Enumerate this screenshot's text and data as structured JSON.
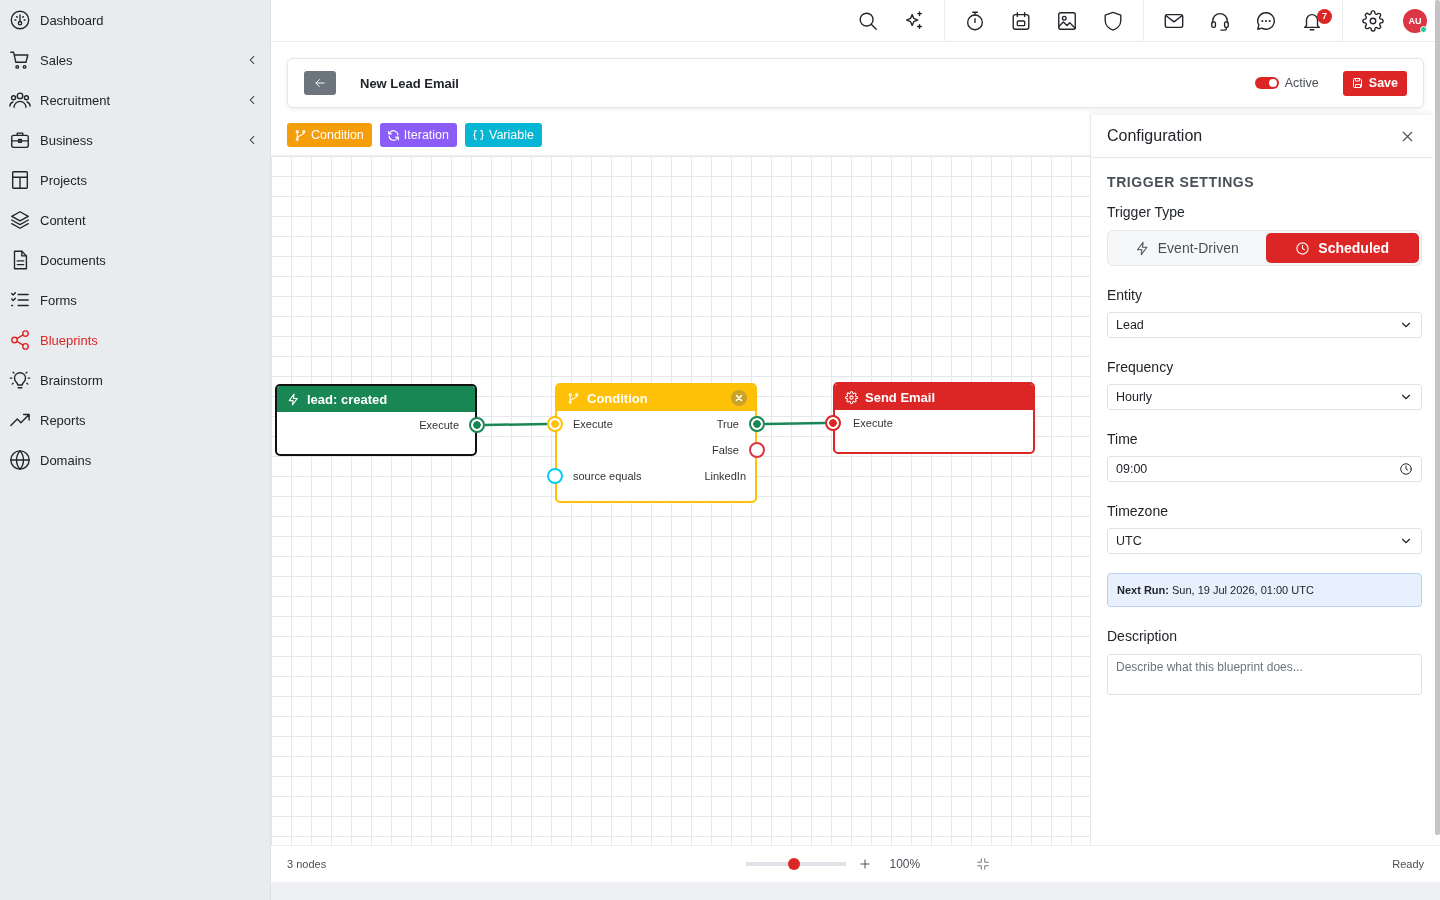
{
  "sidebar": {
    "items": [
      {
        "label": "Dashboard",
        "kind": "link",
        "selected": false
      },
      {
        "label": "Sales",
        "kind": "group",
        "selected": false
      },
      {
        "label": "Recruitment",
        "kind": "group",
        "selected": false
      },
      {
        "label": "Business",
        "kind": "group",
        "selected": false
      },
      {
        "label": "Projects",
        "kind": "link",
        "selected": false
      },
      {
        "label": "Content",
        "kind": "link",
        "selected": false
      },
      {
        "label": "Documents",
        "kind": "link",
        "selected": false
      },
      {
        "label": "Forms",
        "kind": "link",
        "selected": false
      },
      {
        "label": "Blueprints",
        "kind": "link",
        "selected": true
      },
      {
        "label": "Brainstorm",
        "kind": "link",
        "selected": false
      },
      {
        "label": "Reports",
        "kind": "link",
        "selected": false
      },
      {
        "label": "Domains",
        "kind": "link",
        "selected": false
      }
    ]
  },
  "top_bar": {
    "notification_badge": "7",
    "avatar": {
      "initials": "AU",
      "online": true
    }
  },
  "header": {
    "title": "New Lead Email",
    "active_toggle": {
      "label": "Active",
      "on": true
    },
    "save_button": "Save"
  },
  "node_palette": [
    {
      "label": "Condition",
      "color": "#f59e0b"
    },
    {
      "label": "Iteration",
      "color": "#8b5cf6"
    },
    {
      "label": "Variable",
      "color": "#06b6d4"
    }
  ],
  "canvas": {
    "nodes": [
      {
        "kind": "trigger",
        "title": "lead: created",
        "color": "#198754",
        "selected": true,
        "rows": [
          {
            "right": {
              "label": "Execute",
              "port": {
                "color": "#198754",
                "connected": true
              }
            }
          }
        ]
      },
      {
        "kind": "condition",
        "title": "Condition",
        "color": "#ffc107",
        "selected": false,
        "rows": [
          {
            "left": {
              "label": "Execute",
              "port": {
                "color": "#ffc107",
                "connected": true
              }
            },
            "right": {
              "label": "True",
              "port": {
                "color": "#198754",
                "connected": true
              }
            }
          },
          {
            "right": {
              "label": "False",
              "port": {
                "color": "#dc3545",
                "connected": false
              }
            }
          },
          {
            "left": {
              "label": "source equals",
              "port": {
                "color": "#0dcaf0",
                "connected": false
              }
            },
            "right": {
              "label": "LinkedIn"
            }
          }
        ]
      },
      {
        "kind": "action",
        "title": "Send Email",
        "color": "#dc2626",
        "selected": false,
        "rows": [
          {
            "left": {
              "label": "Execute",
              "port": {
                "color": "#dc2626",
                "connected": true
              }
            }
          }
        ]
      }
    ]
  },
  "config_panel": {
    "title": "Configuration",
    "section": "TRIGGER SETTINGS",
    "trigger_type": {
      "label": "Trigger Type",
      "options": [
        {
          "label": "Event-Driven",
          "selected": false
        },
        {
          "label": "Scheduled",
          "selected": true
        }
      ]
    },
    "fields": [
      {
        "kind": "select",
        "label": "Entity",
        "value": "Lead"
      },
      {
        "kind": "select",
        "label": "Frequency",
        "value": "Hourly"
      },
      {
        "kind": "time",
        "label": "Time",
        "value": "09:00"
      },
      {
        "kind": "select",
        "label": "Timezone",
        "value": "UTC"
      }
    ],
    "next_run": "**Next Run:** Sun, 19 Jul 2026, 01:00 UTC",
    "description": {
      "label": "Description",
      "placeholder": "Describe what this blueprint does..."
    }
  },
  "status_bar": {
    "node_count": "3 nodes",
    "zoom": {
      "level": 0.48,
      "reading": "100%"
    },
    "status": "Ready"
  }
}
